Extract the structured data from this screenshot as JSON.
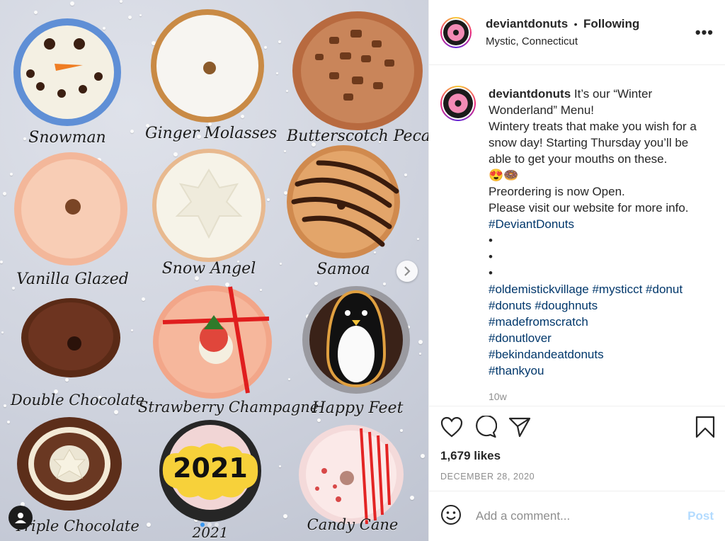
{
  "media": {
    "donuts": [
      {
        "label": "Snowman"
      },
      {
        "label": "Ginger Molasses"
      },
      {
        "label": "Butterscotch Pecan"
      },
      {
        "label": "Vanilla Glazed"
      },
      {
        "label": "Snow Angel"
      },
      {
        "label": "Samoa"
      },
      {
        "label": "Double Chocolate"
      },
      {
        "label": "Strawberry Champagne"
      },
      {
        "label": "Happy Feet"
      },
      {
        "label": "Triple Chocolate"
      },
      {
        "label": "2021"
      },
      {
        "label": "Candy Cane"
      }
    ],
    "year_text": "2021",
    "carousel_pages": 3,
    "carousel_active": 1
  },
  "header": {
    "username": "deviantdonuts",
    "separator": "•",
    "follow_status": "Following",
    "location": "Mystic, Connecticut",
    "more_label": "•••"
  },
  "caption": {
    "username": "deviantdonuts",
    "line1": " It’s our “Winter Wonderland” Menu!",
    "line2": "Wintery treats that make you wish for a snow day! Starting Thursday you’ll be able to get your mouths on these.",
    "emoji": "😍🍩",
    "line3": "Preordering is now Open.",
    "line4": "Please visit our website for more info.",
    "hashtag1": "#DeviantDonuts",
    "bullet": "•",
    "hashtags": [
      "#oldemistickvillage",
      "#mysticct",
      "#donut",
      "#donuts",
      "#doughnuts",
      "#madefromscratch",
      "#donutlover",
      "#bekindandeatdonuts",
      "#thankyou"
    ],
    "time_ago": "10w"
  },
  "actions": {
    "likes": "1,679 likes",
    "date": "DECEMBER 28, 2020"
  },
  "comment": {
    "placeholder": "Add a comment...",
    "post_label": "Post"
  },
  "colors": {
    "link": "#00376b",
    "muted": "#8e8e8e",
    "post_disabled": "#b3dbff"
  }
}
